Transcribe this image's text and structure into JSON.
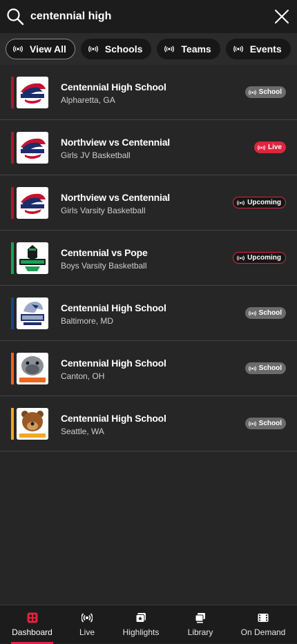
{
  "search": {
    "query": "centennial high"
  },
  "filters": [
    {
      "label": "View All",
      "active": true
    },
    {
      "label": "Schools",
      "active": false
    },
    {
      "label": "Teams",
      "active": false
    },
    {
      "label": "Events",
      "active": false
    }
  ],
  "results": [
    {
      "title": "Centennial High School",
      "subtitle": "Alpharetta, GA",
      "badge": "School",
      "badge_type": "school",
      "accent": "#b0172f",
      "logo_icon": "centennial-knights-logo-icon"
    },
    {
      "title": "Northview vs Centennial",
      "subtitle": "Girls JV Basketball",
      "badge": "Live",
      "badge_type": "live",
      "accent": "#b0172f",
      "logo_icon": "centennial-knights-logo-icon"
    },
    {
      "title": "Northview vs Centennial",
      "subtitle": "Girls Varsity Basketball",
      "badge": "Upcoming",
      "badge_type": "upcoming",
      "accent": "#b0172f",
      "logo_icon": "centennial-knights-logo-icon"
    },
    {
      "title": "Centennial vs Pope",
      "subtitle": "Boys Varsity Basketball",
      "badge": "Upcoming",
      "badge_type": "upcoming",
      "accent": "#1aa154",
      "logo_icon": "spartans-logo-icon"
    },
    {
      "title": "Centennial High School",
      "subtitle": "Baltimore, MD",
      "badge": "School",
      "badge_type": "school",
      "accent": "#1e3f8a",
      "logo_icon": "eagles-logo-icon"
    },
    {
      "title": "Centennial High School",
      "subtitle": "Canton, OH",
      "badge": "School",
      "badge_type": "school",
      "accent": "#f0641e",
      "logo_icon": "bulldogs-logo-icon"
    },
    {
      "title": "Centennial High School",
      "subtitle": "Seattle, WA",
      "badge": "School",
      "badge_type": "school",
      "accent": "#f5a623",
      "logo_icon": "bears-logo-icon"
    }
  ],
  "tabbar": [
    {
      "label": "Dashboard",
      "icon": "dashboard-icon",
      "active": true
    },
    {
      "label": "Live",
      "icon": "broadcast-icon",
      "active": false
    },
    {
      "label": "Highlights",
      "icon": "highlights-icon",
      "active": false
    },
    {
      "label": "Library",
      "icon": "library-icon",
      "active": false
    },
    {
      "label": "On Demand",
      "icon": "film-icon",
      "active": false
    }
  ],
  "colors": {
    "accent_red": "#e0243f",
    "background": "#262626",
    "bar_background": "#1c1c1c"
  }
}
